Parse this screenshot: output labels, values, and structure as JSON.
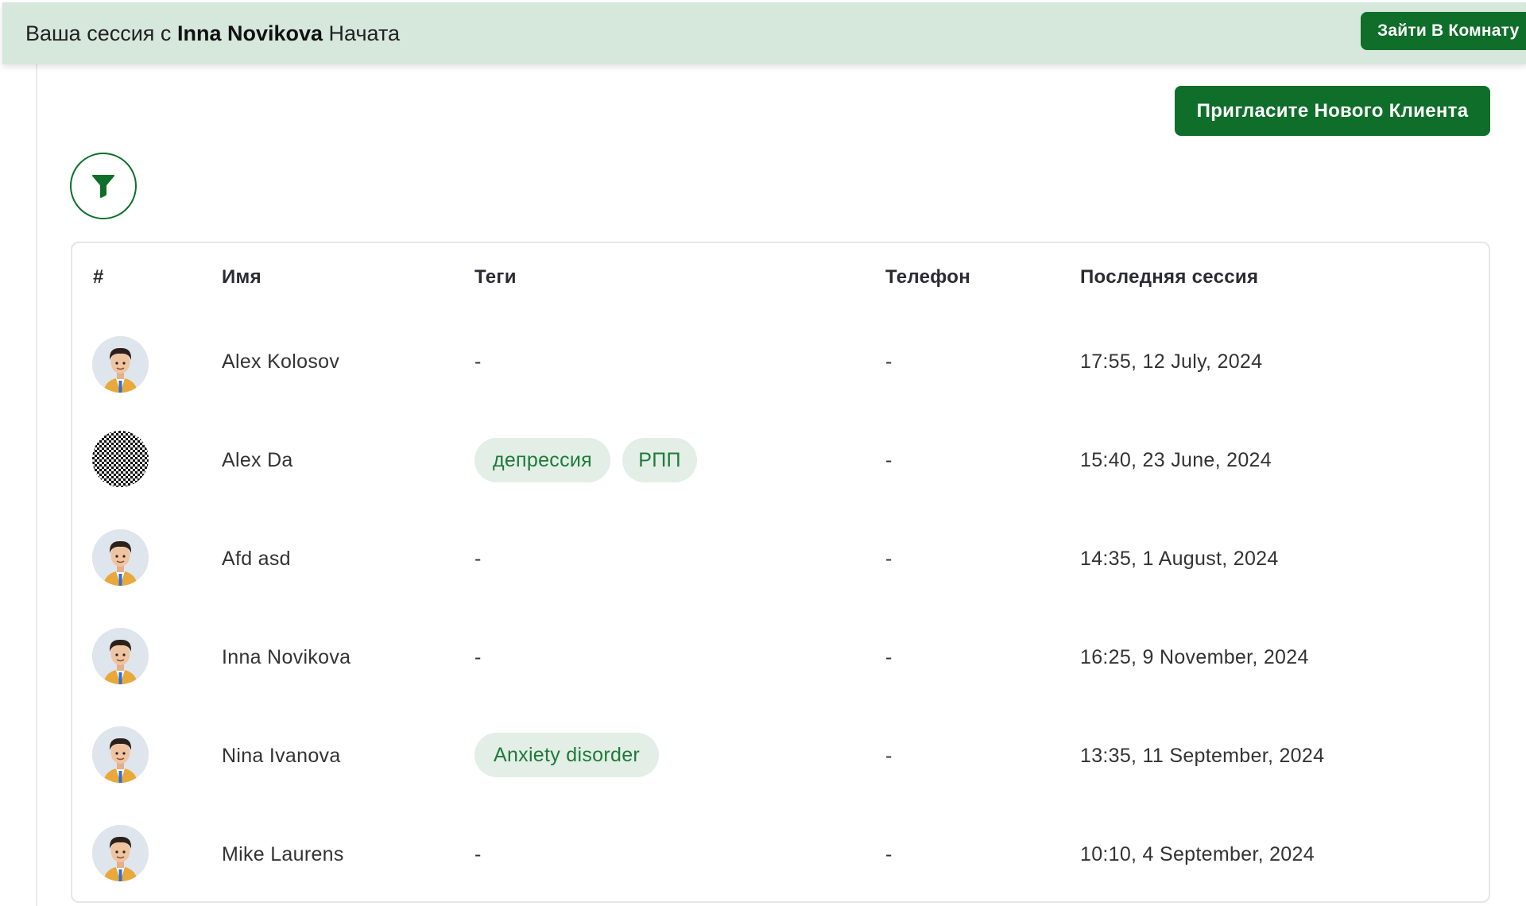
{
  "banner": {
    "prefix": "Ваша сессия с",
    "client_name": "Inna Novikova",
    "suffix": "Начата",
    "enter_button": "Зайти В Комнату"
  },
  "actions": {
    "invite_button": "Пригласите Нового Клиента"
  },
  "icons": {
    "filter": "filter-icon",
    "avatar": "cartoon-man-avatar",
    "avatar_qr": "qr-pattern-avatar"
  },
  "colors": {
    "accent": "#0e6e2a",
    "banner_bg": "#d6e7dc",
    "tag_bg": "#e2eee6",
    "tag_text": "#1f7a3a"
  },
  "table": {
    "headers": {
      "index": "#",
      "name": "Имя",
      "tags": "Теги",
      "phone": "Телефон",
      "last_session": "Последняя сессия"
    },
    "rows": [
      {
        "name": "Alex Kolosov",
        "tags_empty": "-",
        "tags": [],
        "phone": "-",
        "last_session": "17:55, 12 July, 2024"
      },
      {
        "name": "Alex Da",
        "tags": [
          "депрессия",
          "РПП"
        ],
        "phone": "-",
        "last_session": "15:40, 23 June, 2024"
      },
      {
        "name": "Afd asd",
        "tags_empty": "-",
        "tags": [],
        "phone": "-",
        "last_session": "14:35, 1 August, 2024"
      },
      {
        "name": "Inna Novikova",
        "tags_empty": "-",
        "tags": [],
        "phone": "-",
        "last_session": "16:25, 9 November, 2024"
      },
      {
        "name": "Nina Ivanova",
        "tags": [
          "Anxiety disorder"
        ],
        "phone": "-",
        "last_session": "13:35, 11 September, 2024"
      },
      {
        "name": "Mike Laurens",
        "tags_empty": "-",
        "tags": [],
        "phone": "-",
        "last_session": "10:10, 4 September, 2024"
      }
    ]
  }
}
